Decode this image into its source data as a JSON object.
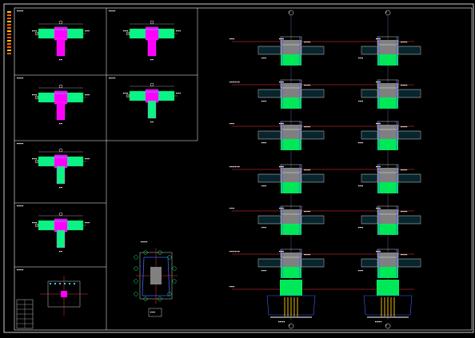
{
  "drawing": {
    "background": "#000000",
    "frame_color": "#ffffff",
    "axis_color": "#ff3030",
    "level_color": "#ff3030",
    "colors": {
      "column_fill": "#ff00ff",
      "beam_fill": "#00ff60",
      "rebar": "#30d0ff",
      "hatch": "#808080",
      "text": "#ffffff",
      "pile": "#ffd000"
    },
    "axis_bubbles": [
      {
        "label": "1"
      },
      {
        "label": "2"
      }
    ],
    "section_marks": [
      "1",
      "2",
      "3",
      "4",
      "5",
      "6"
    ],
    "left_panel_details": 6,
    "elevation_levels": 7
  }
}
